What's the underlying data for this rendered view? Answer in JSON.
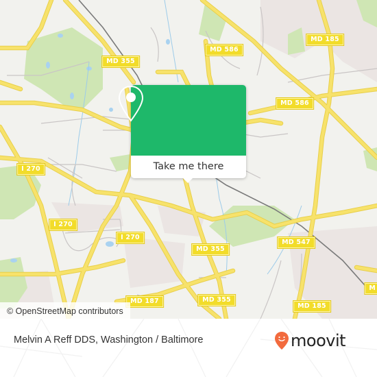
{
  "map": {
    "road_labels": [
      {
        "id": "md355-north",
        "text": "MD 355"
      },
      {
        "id": "md586-north",
        "text": "MD 586"
      },
      {
        "id": "md185-north",
        "text": "MD 185"
      },
      {
        "id": "md586-east",
        "text": "MD 586"
      },
      {
        "id": "i270-west",
        "text": "I 270"
      },
      {
        "id": "i270-center-left",
        "text": "I 270"
      },
      {
        "id": "i270-center",
        "text": "I 270"
      },
      {
        "id": "md355-center",
        "text": "MD 355"
      },
      {
        "id": "md547",
        "text": "MD 547"
      },
      {
        "id": "md187",
        "text": "MD 187"
      },
      {
        "id": "md355-south",
        "text": "MD 355"
      },
      {
        "id": "md185-south",
        "text": "MD 185"
      },
      {
        "id": "edge-partial",
        "text": "M"
      }
    ],
    "attribution": "© OpenStreetMap contributors",
    "colors": {
      "road": "#f7e26b",
      "road_edge": "#e8cf4a",
      "park": "#cfe6b4",
      "water": "#a9d2f0",
      "residential": "#ebe5e3",
      "background": "#f2f2ee",
      "rail": "#7a7a7a"
    }
  },
  "popup": {
    "icon": "location-pin-icon",
    "button_label": "Take me there",
    "color": "#1eb86a"
  },
  "footer": {
    "place_title": "Melvin A Reff DDS, Washington / Baltimore",
    "brand_name": "moovit",
    "brand_icon": "moovit-smiley-pin-icon",
    "brand_color": "#f26a3d"
  }
}
